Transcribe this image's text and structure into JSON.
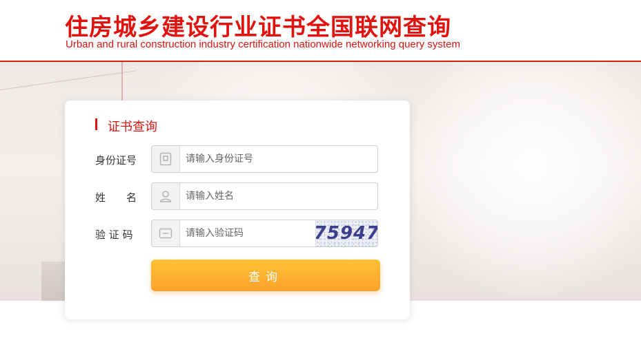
{
  "header": {
    "title_cn": "住房城乡建设行业证书全国联网查询",
    "title_en": "Urban and rural construction industry certification nationwide networking query system"
  },
  "form": {
    "title": "证书查询",
    "id_label": "身份证号",
    "id_placeholder": "请输入身份证号",
    "id_icon": "id-card-icon",
    "name_label": "姓　　名",
    "name_placeholder": "请输入姓名",
    "name_icon": "user-icon",
    "captcha_label": "验 证 码",
    "captcha_placeholder": "请输入验证码",
    "captcha_icon": "keyboard-icon",
    "captcha_value": "75947",
    "submit_label": "查询"
  },
  "colors": {
    "brand_red": "#e0120d",
    "button_orange": "#ffa12e"
  }
}
